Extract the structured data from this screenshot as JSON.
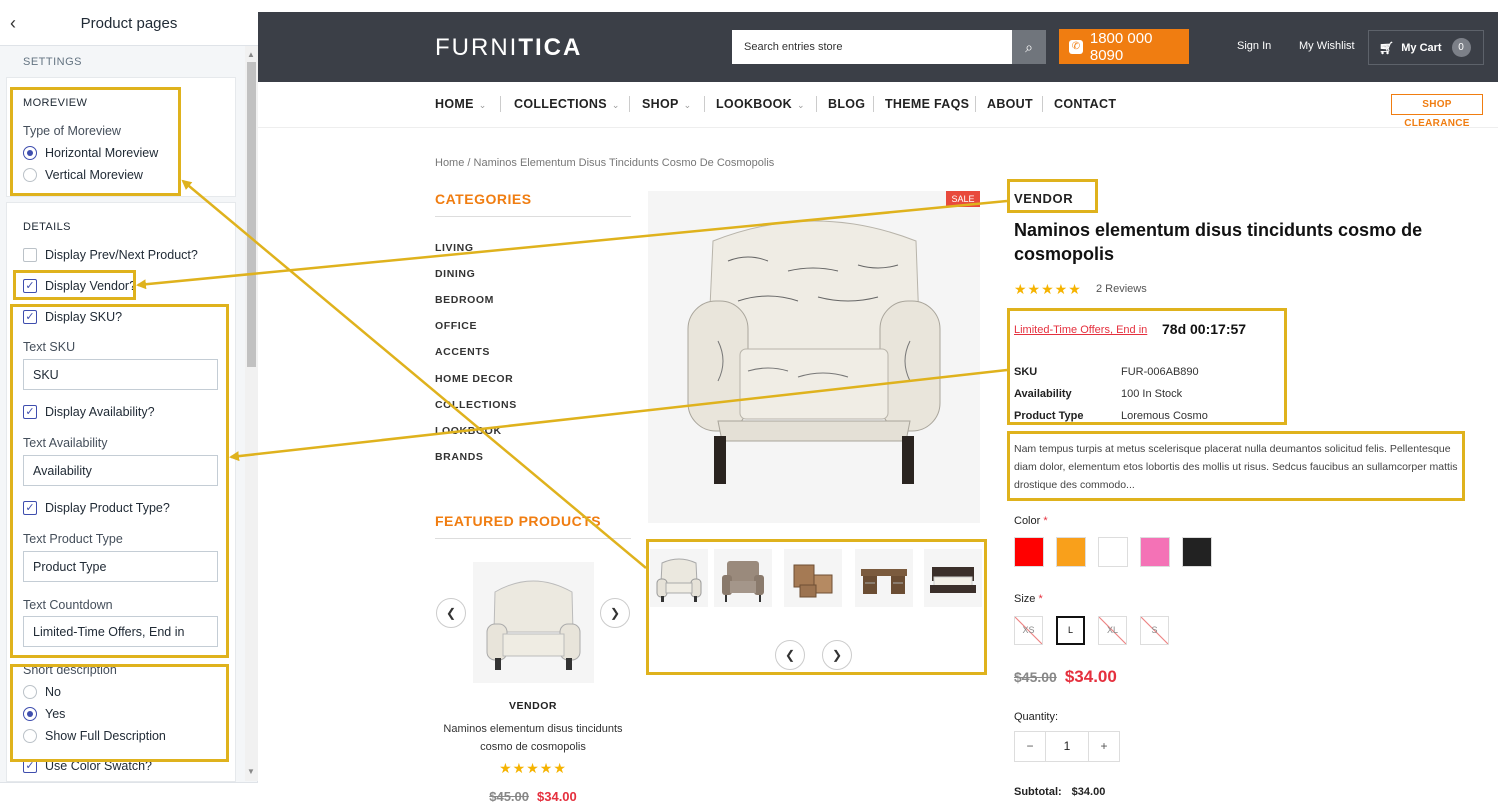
{
  "panel": {
    "title": "Product pages",
    "settings_label": "SETTINGS",
    "moreview": {
      "title": "MOREVIEW",
      "type_label": "Type of Moreview",
      "options": [
        "Horizontal Moreview",
        "Vertical Moreview"
      ],
      "selected": "Horizontal Moreview"
    },
    "details": {
      "title": "DETAILS",
      "prev_next": {
        "label": "Display Prev/Next Product?",
        "checked": false
      },
      "vendor": {
        "label": "Display Vendor?",
        "checked": true
      },
      "sku": {
        "label": "Display SKU?",
        "checked": true
      },
      "text_sku_label": "Text SKU",
      "text_sku_value": "SKU",
      "availability": {
        "label": "Display Availability?",
        "checked": true
      },
      "text_availability_label": "Text Availability",
      "text_availability_value": "Availability",
      "product_type": {
        "label": "Display Product Type?",
        "checked": true
      },
      "text_product_type_label": "Text Product Type",
      "text_product_type_value": "Product Type",
      "text_countdown_label": "Text Countdown",
      "text_countdown_value": "Limited-Time Offers, End in",
      "short_desc_label": "Short description",
      "short_desc_options": [
        "No",
        "Yes",
        "Show Full Description"
      ],
      "short_desc_selected": "Yes",
      "color_swatch": {
        "label": "Use Color Swatch?",
        "checked": true
      }
    }
  },
  "store": {
    "logo_light": "FURNI",
    "logo_bold": "TICA",
    "search_placeholder": "Search entries store",
    "phone": "1800 000 8090",
    "sign_in": "Sign In",
    "wishlist": "My Wishlist",
    "cart_label": "My Cart",
    "cart_count": "0",
    "nav": [
      "HOME",
      "COLLECTIONS",
      "SHOP",
      "LOOKBOOK",
      "BLOG",
      "THEME FAQS",
      "ABOUT",
      "CONTACT"
    ],
    "clearance": "SHOP CLEARANCE",
    "breadcrumb": "Home   /   Naminos Elementum Disus Tincidunts Cosmo De Cosmopolis",
    "categories_title": "CATEGORIES",
    "categories": [
      "LIVING",
      "DINING",
      "BEDROOM",
      "OFFICE",
      "ACCENTS",
      "HOME DECOR",
      "COLLECTIONS",
      "LOOKBOOK",
      "BRANDS"
    ],
    "featured_title": "FEATURED PRODUCTS",
    "featured": {
      "vendor": "VENDOR",
      "name": "Naminos elementum disus tincidunts cosmo de cosmopolis",
      "stars": "★★★★★",
      "old_price": "$45.00",
      "new_price": "$34.00"
    },
    "sale_badge": "SALE",
    "product": {
      "vendor": "VENDOR",
      "title": "Naminos elementum disus tincidunts cosmo de cosmopolis",
      "stars": "★★★★★",
      "reviews": "2 Reviews",
      "countdown_label": "Limited-Time Offers, End in",
      "countdown": "78d 00:17:57",
      "sku_label": "SKU",
      "sku": "FUR-006AB890",
      "availability_label": "Availability",
      "availability": "100 In Stock",
      "type_label": "Product Type",
      "type": "Loremous Cosmo",
      "description": "Nam tempus turpis at metus scelerisque placerat nulla deumantos solicitud felis. Pellentesque diam dolor, elementum etos lobortis des mollis ut risus. Sedcus faucibus an sullamcorper mattis drostique des commodo...",
      "color_label": "Color",
      "colors": [
        "#ff0000",
        "#f9a01b",
        "#ffffff",
        "#f472b6",
        "#222222"
      ],
      "size_label": "Size",
      "sizes": [
        "XS",
        "L",
        "XL",
        "S"
      ],
      "selected_size": "L",
      "old_price": "$45.00",
      "new_price": "$34.00",
      "quantity_label": "Quantity:",
      "quantity": "1",
      "subtotal_label": "Subtotal:",
      "subtotal": "$34.00"
    }
  },
  "colors": {
    "accent": "#f07d11",
    "header": "#3b3f47",
    "annotation": "#dfb21d",
    "price": "#e5303e"
  }
}
